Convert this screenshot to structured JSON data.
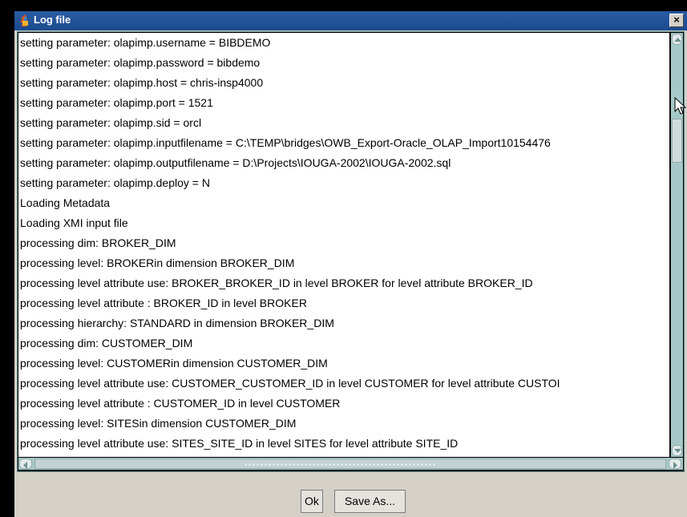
{
  "window": {
    "title": "Log file",
    "close_glyph": "×"
  },
  "log": {
    "lines": [
      "setting parameter: olapimp.username = BIBDEMO",
      "setting parameter: olapimp.password = bibdemo",
      "setting parameter: olapimp.host = chris-insp4000",
      "setting parameter: olapimp.port = 1521",
      "setting parameter: olapimp.sid = orcl",
      "setting parameter: olapimp.inputfilename = C:\\TEMP\\bridges\\OWB_Export-Oracle_OLAP_Import10154476",
      "setting parameter: olapimp.outputfilename = D:\\Projects\\IOUGA-2002\\IOUGA-2002.sql",
      "setting parameter: olapimp.deploy = N",
      "Loading Metadata",
      "Loading XMI input file",
      "processing dim: BROKER_DIM",
      "processing level: BROKERin dimension BROKER_DIM",
      "processing level attribute use: BROKER_BROKER_ID in level BROKER for level attribute BROKER_ID",
      "processing level attribute : BROKER_ID in level BROKER",
      "processing hierarchy: STANDARD in dimension BROKER_DIM",
      "processing dim: CUSTOMER_DIM",
      "processing level: CUSTOMERin dimension CUSTOMER_DIM",
      "processing level attribute use: CUSTOMER_CUSTOMER_ID in level CUSTOMER for level attribute CUSTOI",
      "processing level attribute : CUSTOMER_ID in level CUSTOMER",
      "processing level: SITESin dimension CUSTOMER_DIM",
      "processing level attribute use: SITES_SITE_ID in level SITES for level attribute SITE_ID"
    ]
  },
  "buttons": {
    "ok": "Ok",
    "save_as": "Save As..."
  },
  "colors": {
    "titlebar": "#1b4a8e",
    "scrollbar": "#a6c8c8",
    "window_bg": "#d4d0c8"
  }
}
